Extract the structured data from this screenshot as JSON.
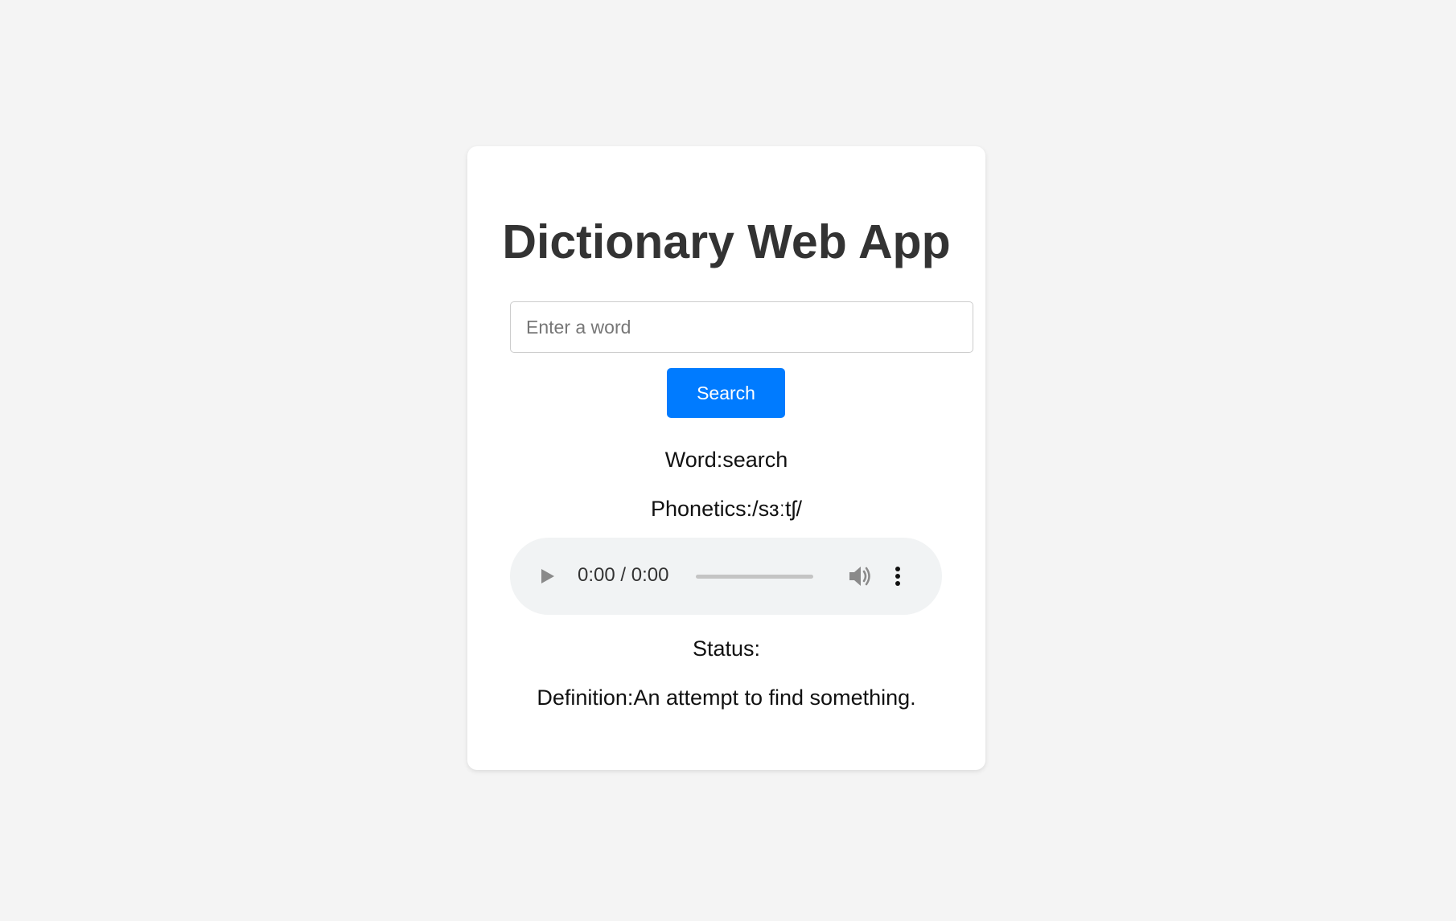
{
  "app": {
    "title": "Dictionary Web App"
  },
  "search": {
    "placeholder": "Enter a word",
    "value": "",
    "button_label": "Search"
  },
  "result": {
    "word_label": "Word:",
    "word": "search",
    "phonetics_label": "Phonetics:",
    "phonetics": "/sɜːtʃ/",
    "status_label": "Status:",
    "status": "",
    "definition_label": "Definition:",
    "definition": "An attempt to find something."
  },
  "audio_player": {
    "time_display": "0:00 / 0:00",
    "progress": 0,
    "icons": {
      "play": "play-icon",
      "volume": "volume-icon",
      "more": "more-options-icon"
    }
  },
  "colors": {
    "page_background": "#f4f4f4",
    "card_background": "#ffffff",
    "accent": "#007bff",
    "title_text": "#333333",
    "player_background": "#f1f3f4"
  }
}
